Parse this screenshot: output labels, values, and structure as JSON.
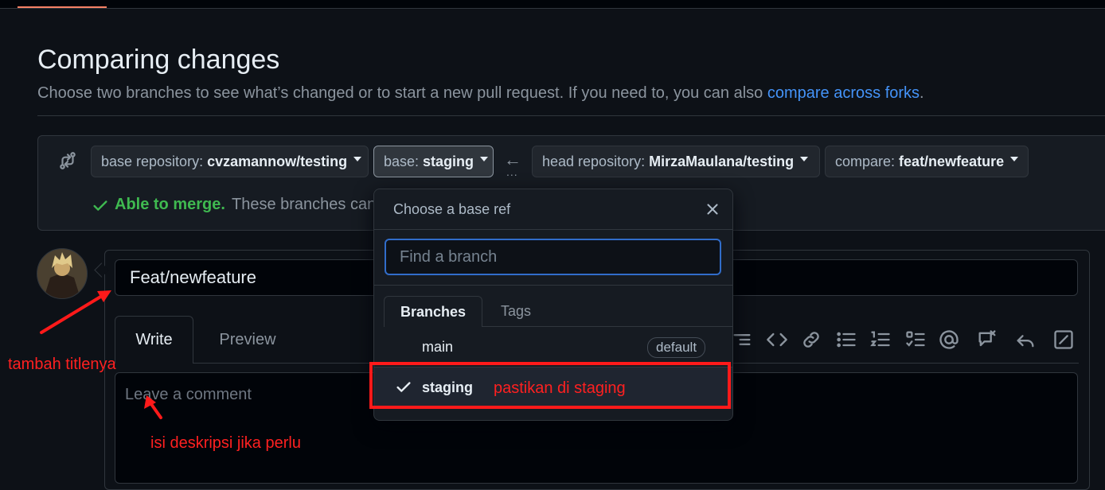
{
  "header": {
    "title": "Comparing changes",
    "subtitle": "Choose two branches to see what’s changed or to start a new pull request. If you need to, you can also ",
    "subtitle_link": "compare across forks",
    "subtitle_end": "."
  },
  "range": {
    "base_repo_label": "base repository:",
    "base_repo_value": "cvzamannow/testing",
    "base_label": "base:",
    "base_value": "staging",
    "arrow": "←",
    "dots": "...",
    "head_repo_label": "head repository:",
    "head_repo_value": "MirzaMaulana/testing",
    "compare_label": "compare:",
    "compare_value": "feat/newfeature",
    "merge_ok": "Able to merge.",
    "merge_rest": "These branches can"
  },
  "form": {
    "title_value": "Feat/newfeature",
    "tab_write": "Write",
    "tab_preview": "Preview",
    "comment_placeholder": "Leave a comment"
  },
  "dropdown": {
    "title": "Choose a base ref",
    "search_placeholder": "Find a branch",
    "tab_branches": "Branches",
    "tab_tags": "Tags",
    "items": [
      {
        "label": "main",
        "badge": "default",
        "selected": false
      },
      {
        "label": "staging",
        "selected": true
      }
    ]
  },
  "annotations": {
    "staging_note": "pastikan di staging",
    "title_note": "tambah titlenya",
    "desc_note": "isi deskripsi jika perlu",
    "color": "#ff1a1a"
  },
  "colors": {
    "background": "#0d1117",
    "link": "#4493f8",
    "success": "#3fb950"
  }
}
